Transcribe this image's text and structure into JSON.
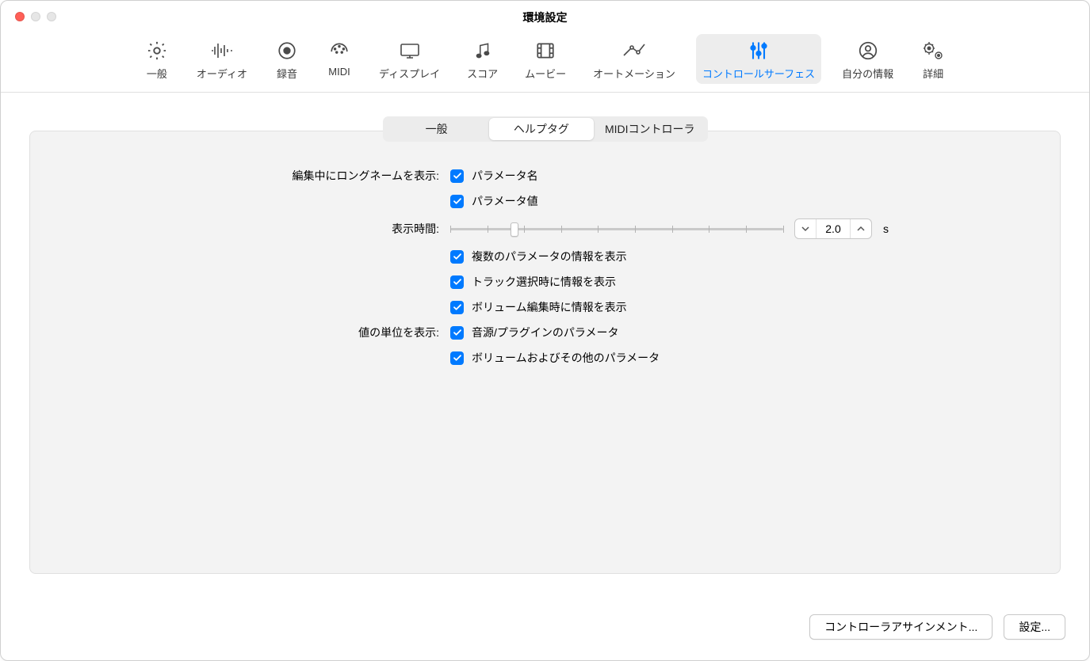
{
  "window": {
    "title": "環境設定"
  },
  "toolbar": {
    "items": [
      {
        "id": "general",
        "label": "一般"
      },
      {
        "id": "audio",
        "label": "オーディオ"
      },
      {
        "id": "record",
        "label": "録音"
      },
      {
        "id": "midi",
        "label": "MIDI"
      },
      {
        "id": "display",
        "label": "ディスプレイ"
      },
      {
        "id": "score",
        "label": "スコア"
      },
      {
        "id": "movie",
        "label": "ムービー"
      },
      {
        "id": "automation",
        "label": "オートメーション"
      },
      {
        "id": "ctrlsurf",
        "label": "コントロールサーフェス"
      },
      {
        "id": "myinfo",
        "label": "自分の情報"
      },
      {
        "id": "advanced",
        "label": "詳細"
      }
    ]
  },
  "segmented": {
    "general": "一般",
    "helptags": "ヘルプタグ",
    "midictrl": "MIDIコントローラ"
  },
  "form": {
    "longname_label": "編集中にロングネームを表示:",
    "param_name": "パラメータ名",
    "param_value": "パラメータ値",
    "duration_label": "表示時間:",
    "duration_value": "2.0",
    "duration_unit": "s",
    "multi_param": "複数のパラメータの情報を表示",
    "track_select": "トラック選択時に情報を表示",
    "volume_edit": "ボリューム編集時に情報を表示",
    "unit_label": "値の単位を表示:",
    "instr_plugin": "音源/プラグインのパラメータ",
    "volume_other": "ボリュームおよびその他のパラメータ"
  },
  "footer": {
    "assignments": "コントローラアサインメント...",
    "setup": "設定..."
  }
}
